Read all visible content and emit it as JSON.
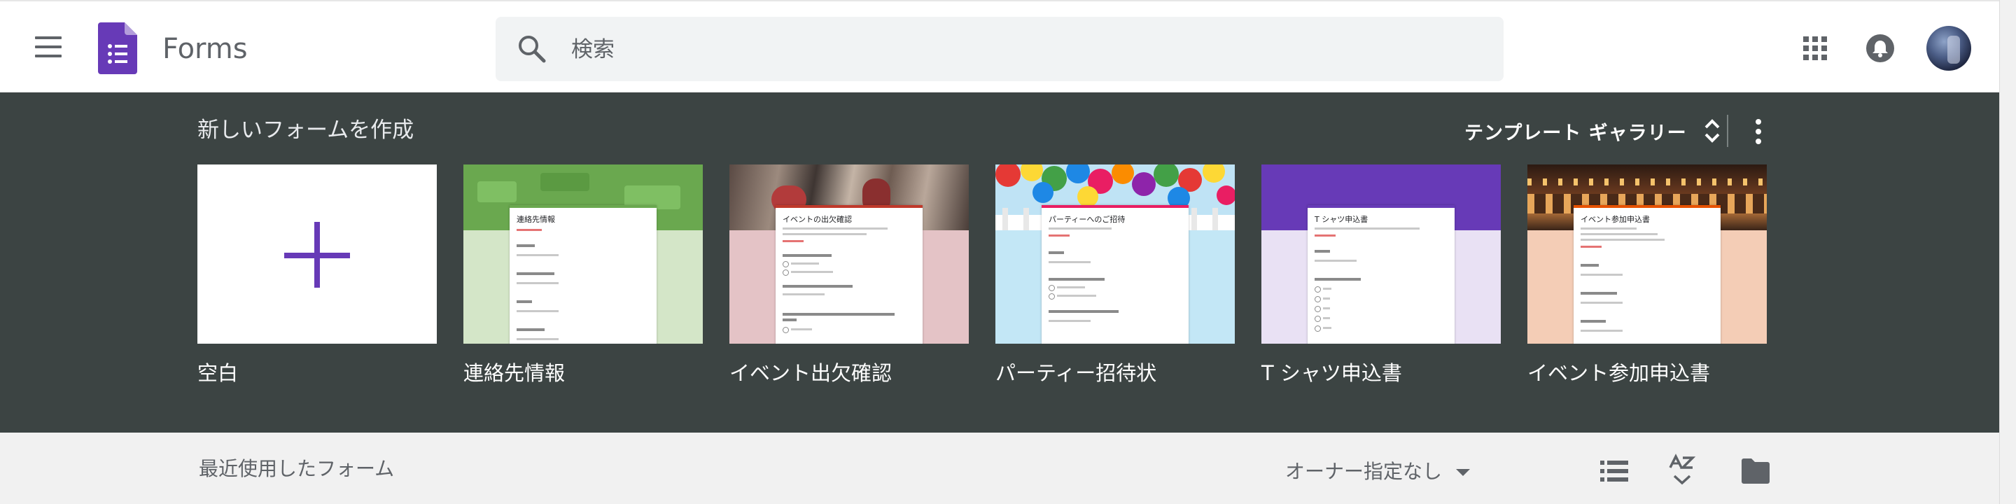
{
  "app": {
    "title": "Forms"
  },
  "search": {
    "placeholder": "検索",
    "value": ""
  },
  "header_icons": [
    "menu-icon",
    "forms-logo-icon",
    "search-icon",
    "apps-icon",
    "bell-icon",
    "avatar"
  ],
  "colors": {
    "brand": "#673ab7",
    "band_bg": "#3c4443",
    "recent_bg": "#f1f1f1"
  },
  "templates_section": {
    "title": "新しいフォームを作成",
    "gallery_label": "テンプレート ギャラリー",
    "cards": [
      {
        "label": "空白"
      },
      {
        "label": "連絡先情報",
        "preview_title": "連絡先情報"
      },
      {
        "label": "イベント出欠確認",
        "preview_title": "イベントの出欠確認"
      },
      {
        "label": "パーティー招待状",
        "preview_title": "パーティーへのご招待"
      },
      {
        "label": "T シャツ申込書",
        "preview_title": "T シャツ申込書"
      },
      {
        "label": "イベント参加申込書",
        "preview_title": "イベント参加申込書"
      }
    ]
  },
  "recent_section": {
    "title": "最近使用したフォーム",
    "owner_filter": "オーナー指定なし"
  }
}
